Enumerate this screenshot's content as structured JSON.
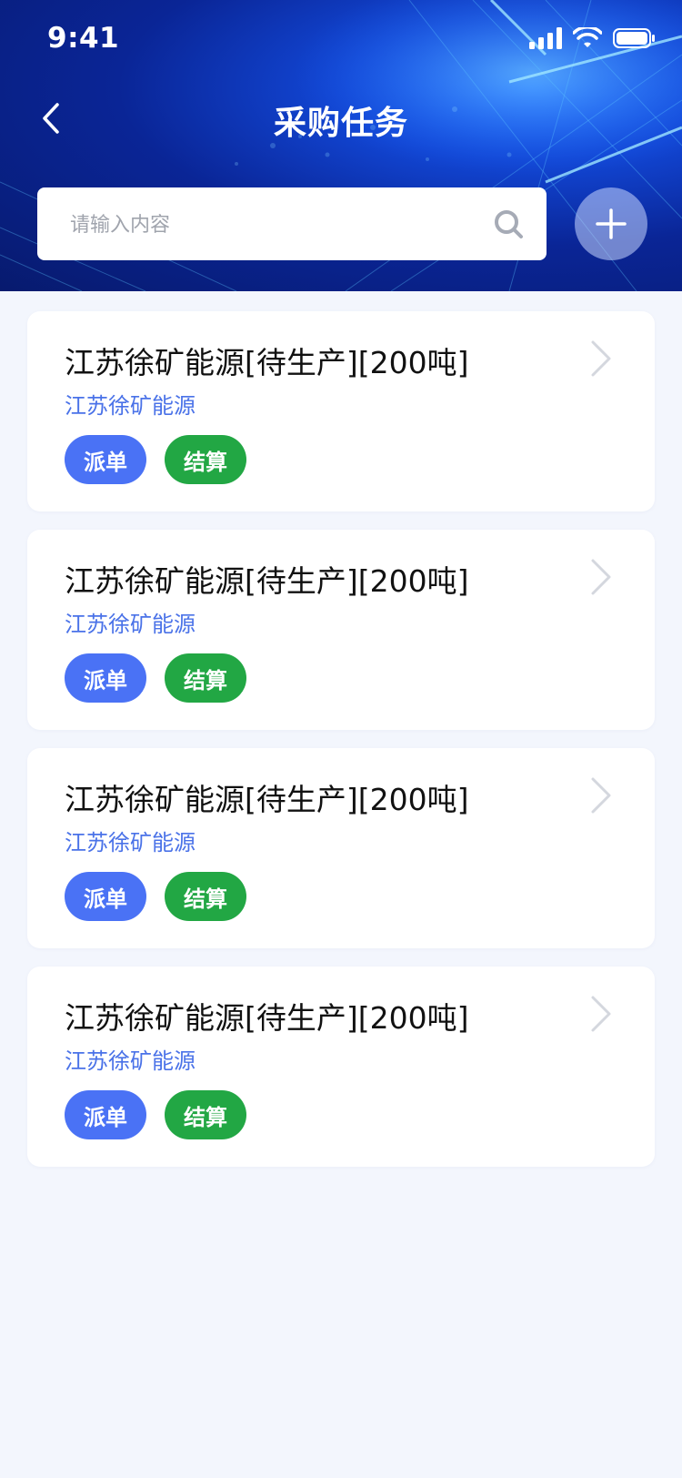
{
  "status_bar": {
    "time": "9:41"
  },
  "nav": {
    "title": "采购任务",
    "back_icon": "chevron-left-icon"
  },
  "search": {
    "placeholder": "请输入内容",
    "value": "",
    "icon": "search-icon"
  },
  "add_button": {
    "icon": "plus-icon"
  },
  "colors": {
    "header_dark": "#071a6e",
    "header_bright": "#1e6bff",
    "dispatch_tag": "#4a72f5",
    "settle_tag": "#22a744",
    "subtitle": "#4a72e8",
    "page_bg": "#f3f6fd"
  },
  "tasks": [
    {
      "title": "江苏徐矿能源[待生产][200吨]",
      "company": "江苏徐矿能源",
      "dispatch_label": "派单",
      "settle_label": "结算"
    },
    {
      "title": "江苏徐矿能源[待生产][200吨]",
      "company": "江苏徐矿能源",
      "dispatch_label": "派单",
      "settle_label": "结算"
    },
    {
      "title": "江苏徐矿能源[待生产][200吨]",
      "company": "江苏徐矿能源",
      "dispatch_label": "派单",
      "settle_label": "结算"
    },
    {
      "title": "江苏徐矿能源[待生产][200吨]",
      "company": "江苏徐矿能源",
      "dispatch_label": "派单",
      "settle_label": "结算"
    }
  ]
}
